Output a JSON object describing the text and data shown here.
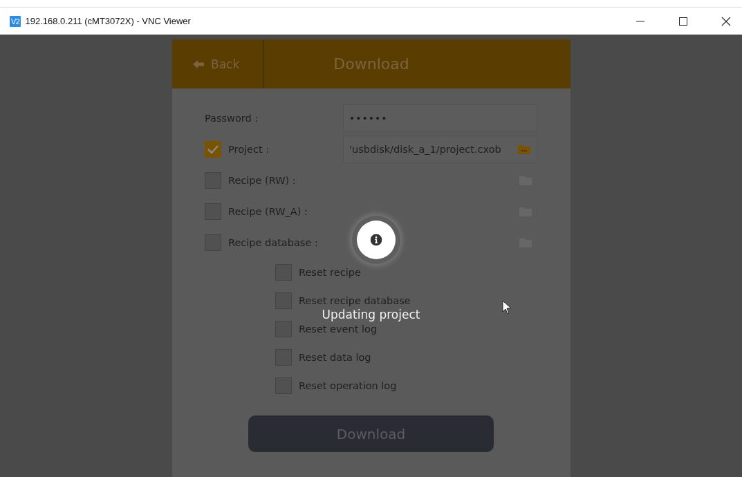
{
  "window": {
    "title": "192.168.0.211 (cMT3072X) - VNC Viewer",
    "app_badge": "V2"
  },
  "header": {
    "back": "Back",
    "title": "Download"
  },
  "password": {
    "label": "Password :",
    "value": "••••••"
  },
  "options": [
    {
      "kind": "file",
      "label": "Project :",
      "checked": true,
      "path": "'usbdisk/disk_a_1/project.cxob",
      "disabled": false
    },
    {
      "kind": "file",
      "label": "Recipe (RW) :",
      "checked": false,
      "disabled": true
    },
    {
      "kind": "file",
      "label": "Recipe (RW_A) :",
      "checked": false,
      "disabled": true
    },
    {
      "kind": "file",
      "label": "Recipe database :",
      "checked": false,
      "disabled": true
    },
    {
      "kind": "reset",
      "label": "Reset recipe",
      "checked": false
    },
    {
      "kind": "reset",
      "label": "Reset recipe database",
      "checked": false
    },
    {
      "kind": "reset",
      "label": "Reset event log",
      "checked": false
    },
    {
      "kind": "reset",
      "label": "Reset data log",
      "checked": false
    },
    {
      "kind": "reset",
      "label": "Reset operation log",
      "checked": false
    }
  ],
  "download_button": {
    "label": "Download",
    "disabled": true
  },
  "overlay": {
    "message": "Updating project"
  }
}
